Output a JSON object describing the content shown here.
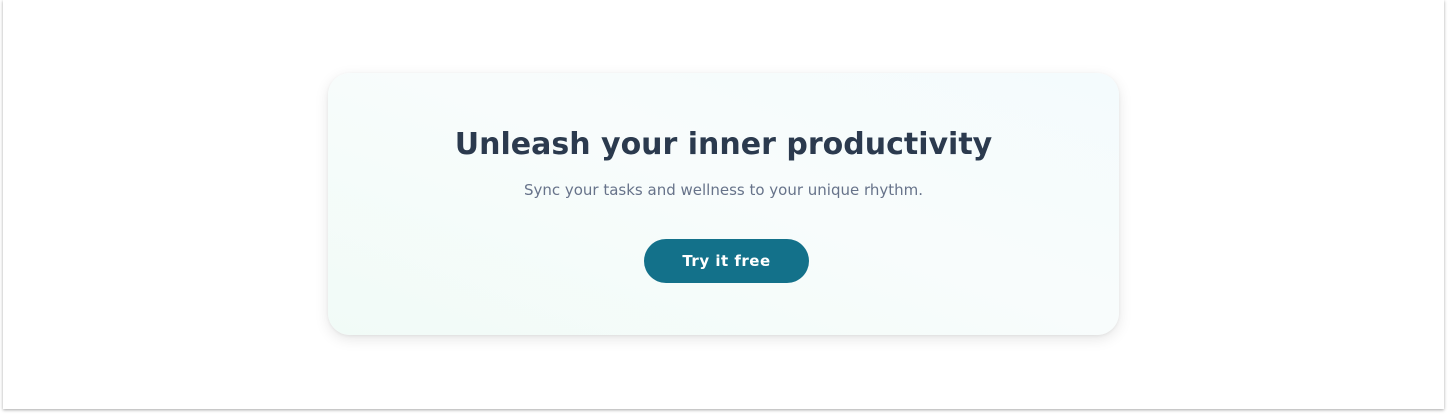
{
  "hero": {
    "title": "Unleash your inner productivity",
    "subtitle": "Sync your tasks and wellness to your unique rhythm.",
    "cta_label": "Try it free"
  },
  "colors": {
    "cta_background": "#13718a",
    "title_text": "#2b3a4e",
    "subtitle_text": "#67738a"
  }
}
